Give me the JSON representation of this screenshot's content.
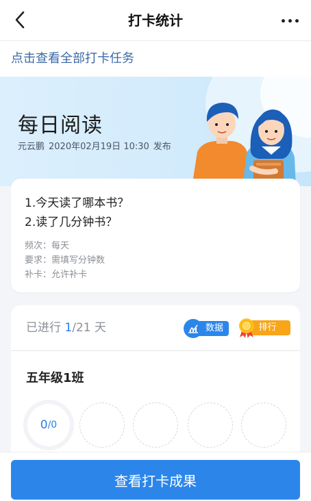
{
  "header": {
    "title": "打卡统计"
  },
  "all_tasks_link": "点击查看全部打卡任务",
  "banner": {
    "title": "每日阅读",
    "author": "元云鹏",
    "published": "2020年02月19日 10:30",
    "publish_suffix": "发布"
  },
  "task": {
    "questions": [
      "1.今天读了哪本书？",
      "2.读了几分钟书？"
    ],
    "frequency": "频次：每天",
    "requirement": "要求：需填写分钟数",
    "makeup": "补卡：允许补卡"
  },
  "progress": {
    "prefix": "已进行 ",
    "current": "1",
    "total_suffix": "/21 天",
    "data_button": "数据",
    "rank_button": "排行榜",
    "class_name": "五年级1班",
    "submitted": "0",
    "submitted_total": "/0"
  },
  "cta_label": "查看打卡成果",
  "colors": {
    "accent": "#2c86ea",
    "link": "#3d6aa6",
    "rank": "#f8a51a"
  }
}
